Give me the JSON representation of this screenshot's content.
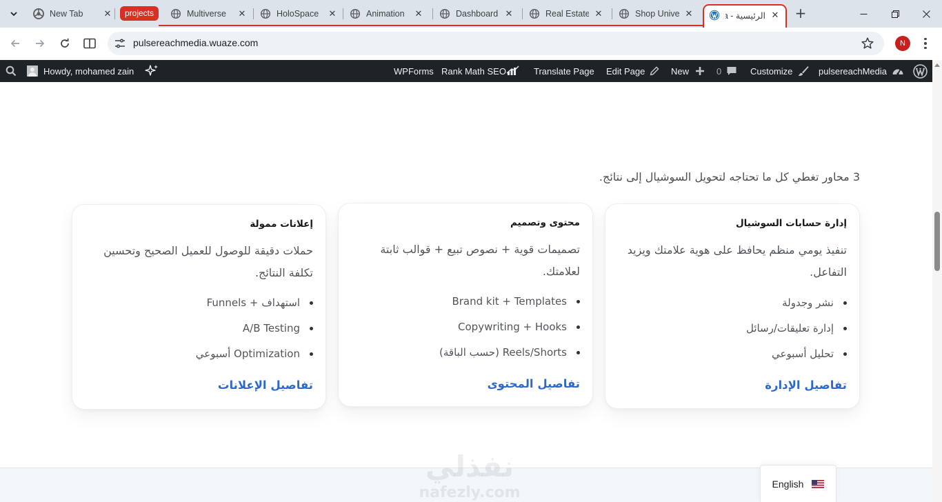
{
  "browser": {
    "tabs": [
      {
        "title": "New Tab",
        "favicon": "chrome-icon"
      },
      {
        "title": "Multiverse",
        "favicon": "globe-icon"
      },
      {
        "title": "HoloSpace",
        "favicon": "globe-icon"
      },
      {
        "title": "Animation",
        "favicon": "globe-icon"
      },
      {
        "title": "Dashboard",
        "favicon": "globe-icon"
      },
      {
        "title": "Real Estate",
        "favicon": "globe-icon"
      },
      {
        "title": "Shop Unive",
        "favicon": "globe-icon"
      },
      {
        "title": "الرئيسية - a",
        "favicon": "wordpress-icon",
        "active": true
      }
    ],
    "tab_group": {
      "label": "projects",
      "color": "#d93025"
    },
    "address": "pulsereachmedia.wuaze.com",
    "profile_initial": "N",
    "profile_color": "#c5221f"
  },
  "admin_bar": {
    "howdy": "Howdy, mohamed zain",
    "items": {
      "wpforms": "WPForms",
      "rank_math": "Rank Math SEO",
      "translate": "Translate Page",
      "edit_page": "Edit Page",
      "new": "New",
      "comments_count": "0",
      "customize": "Customize",
      "site_name": "pulsereachMedia"
    },
    "background": "#1d2327"
  },
  "page": {
    "intro": "3 محاور تغطي كل ما تحتاجه لتحويل السوشيال إلى نتائج.",
    "cards": [
      {
        "title": "إدارة حسابات السوشيال",
        "description_lines": [
          "تنفيذ يومي منظم يحافظ على هوية علامتك ويزيد",
          "التفاعل."
        ],
        "bullets": [
          "نشر وجدولة",
          "إدارة تعليقات/رسائل",
          "تحليل أسبوعي"
        ],
        "link": "تفاصيل الإدارة"
      },
      {
        "title": "محتوى وتصميم",
        "description_lines": [
          "تصميمات قوية + نصوص تبيع + قوالب ثابتة",
          "لعلامتك."
        ],
        "bullets": [
          "Brand kit + Templates",
          "Copywriting + Hooks",
          "Reels/Shorts (حسب الباقة)"
        ],
        "link": "تفاصيل المحتوى"
      },
      {
        "title": "إعلانات ممولة",
        "description_lines": [
          "حملات دقيقة للوصول للعميل الصحيح وتحسين",
          "تكلفة النتائج."
        ],
        "bullets": [
          "استهداف + Funnels",
          "A/B Testing",
          "Optimization أسبوعي"
        ],
        "link": "تفاصيل الإعلانات"
      }
    ],
    "link_color": "#2e69c9",
    "language_switcher": {
      "label": "English",
      "flag": "us-flag-icon"
    },
    "watermark": {
      "arabic": "نفذلي",
      "latin": "nafezly.com"
    }
  }
}
